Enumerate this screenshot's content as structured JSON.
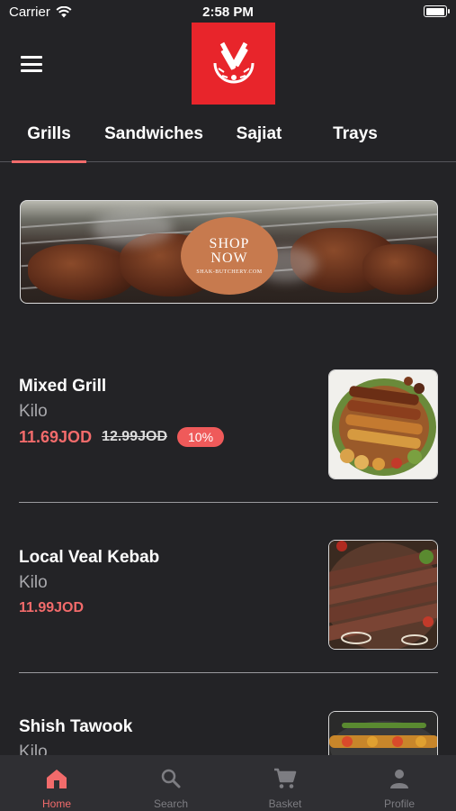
{
  "status_bar": {
    "carrier": "Carrier",
    "time": "2:58 PM",
    "battery_level": 1.0
  },
  "header": {
    "menu_icon": "hamburger-menu-icon",
    "logo_icon": "butcher-knife-cleaver-logo",
    "logo_color": "#e8252b"
  },
  "tabs": [
    {
      "label": "Grills",
      "active": true
    },
    {
      "label": "Sandwiches",
      "active": false
    },
    {
      "label": "Sajiat",
      "active": false
    },
    {
      "label": "Trays",
      "active": false
    }
  ],
  "banner": {
    "line1": "SHOP",
    "line2": "NOW",
    "url": "SHAK-BUTCHERY.COM"
  },
  "products": [
    {
      "name": "Mixed Grill",
      "unit": "Kilo",
      "price": "11.69JOD",
      "old_price": "12.99JOD",
      "discount": "10%"
    },
    {
      "name": "Local Veal Kebab",
      "unit": "Kilo",
      "price": "11.99JOD"
    },
    {
      "name": "Shish Tawook",
      "unit": "Kilo"
    }
  ],
  "bottom_nav": [
    {
      "label": "Home",
      "icon": "home-icon",
      "active": true
    },
    {
      "label": "Search",
      "icon": "search-icon",
      "active": false
    },
    {
      "label": "Basket",
      "icon": "cart-icon",
      "active": false
    },
    {
      "label": "Profile",
      "icon": "person-icon",
      "active": false
    }
  ],
  "colors": {
    "accent": "#f26b6b",
    "background": "#232326",
    "nav_background": "#2f2f33",
    "badge": "#ef5a5a"
  }
}
